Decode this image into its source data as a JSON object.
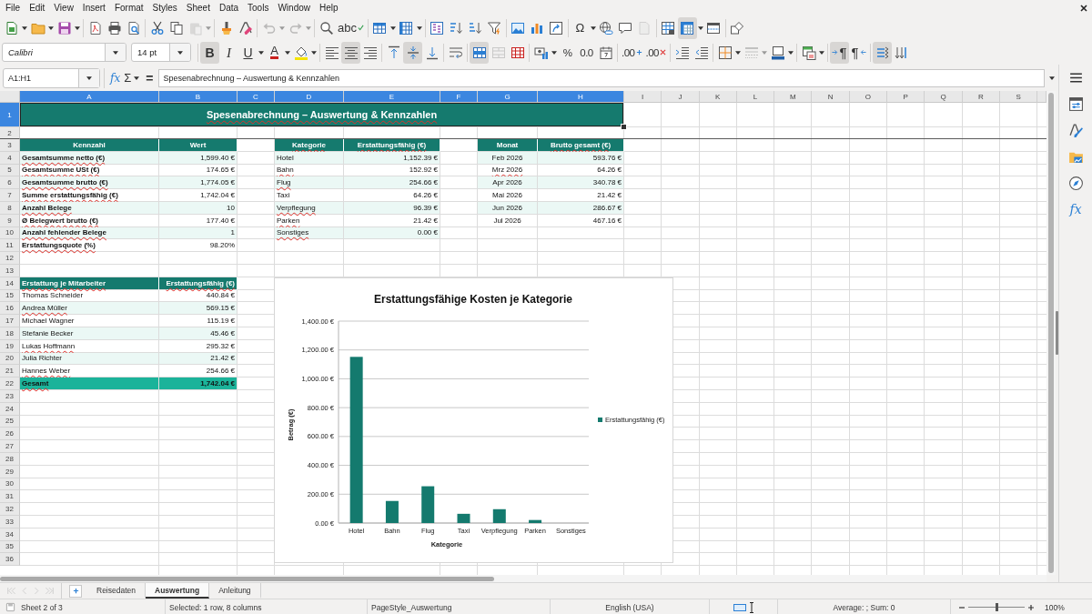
{
  "menu_bar": {
    "items": [
      "File",
      "Edit",
      "View",
      "Insert",
      "Format",
      "Styles",
      "Sheet",
      "Data",
      "Tools",
      "Window",
      "Help"
    ]
  },
  "standard_toolbar": {
    "buttons": [
      {
        "kind": "new",
        "pressed": false,
        "disabled": false
      },
      {
        "kind": "open",
        "pressed": false,
        "disabled": false
      },
      {
        "kind": "save",
        "pressed": false,
        "disabled": false
      },
      {
        "kind": "pdf",
        "pressed": false,
        "disabled": false
      },
      {
        "kind": "print",
        "pressed": false,
        "disabled": false
      },
      {
        "kind": "preview",
        "pressed": false,
        "disabled": false
      },
      {
        "kind": "cut",
        "pressed": false,
        "disabled": false
      },
      {
        "kind": "copy",
        "pressed": false,
        "disabled": false
      },
      {
        "kind": "paste",
        "pressed": false,
        "disabled": true
      },
      {
        "kind": "clone",
        "pressed": false,
        "disabled": false
      },
      {
        "kind": "clear",
        "pressed": false,
        "disabled": false
      },
      {
        "kind": "undo",
        "pressed": false,
        "disabled": true
      },
      {
        "kind": "redo",
        "pressed": false,
        "disabled": true
      },
      {
        "kind": "find",
        "pressed": false,
        "disabled": false
      },
      {
        "kind": "spelling",
        "glyph": "abc",
        "pressed": false,
        "disabled": false
      },
      {
        "kind": "rows",
        "pressed": false,
        "disabled": false
      },
      {
        "kind": "columns",
        "pressed": false,
        "disabled": false
      },
      {
        "kind": "sort",
        "pressed": false,
        "disabled": false
      },
      {
        "kind": "ascending",
        "pressed": false,
        "disabled": false
      },
      {
        "kind": "descending",
        "pressed": false,
        "disabled": false
      },
      {
        "kind": "filter",
        "pressed": false,
        "disabled": false
      },
      {
        "kind": "image",
        "pressed": false,
        "disabled": false
      },
      {
        "kind": "chart",
        "pressed": false,
        "disabled": false
      },
      {
        "kind": "pivot",
        "pressed": false,
        "disabled": false
      },
      {
        "kind": "character",
        "glyph": "Ω",
        "pressed": false,
        "disabled": false
      },
      {
        "kind": "hyperlink",
        "pressed": false,
        "disabled": false
      },
      {
        "kind": "comment",
        "pressed": false,
        "disabled": false
      },
      {
        "kind": "headers",
        "pressed": false,
        "disabled": true
      },
      {
        "kind": "area",
        "pressed": false,
        "disabled": false
      },
      {
        "kind": "freeze",
        "pressed": true,
        "disabled": false
      },
      {
        "kind": "split",
        "pressed": false,
        "disabled": false
      },
      {
        "kind": "shapes",
        "pressed": false,
        "disabled": false
      }
    ]
  },
  "formatting_toolbar": {
    "font_name": "Calibri",
    "font_size": "14 pt",
    "buttons": [
      {
        "kind": "bold",
        "glyph": "B",
        "pressed": true,
        "disabled": false
      },
      {
        "kind": "italic",
        "glyph": "I",
        "pressed": false,
        "disabled": false
      },
      {
        "kind": "underline",
        "glyph": "U",
        "pressed": false,
        "disabled": false
      },
      {
        "kind": "color",
        "glyph": "A",
        "pressed": false,
        "disabled": false
      },
      {
        "kind": "highlight",
        "pressed": false,
        "disabled": false
      },
      {
        "kind": "left",
        "pressed": false,
        "disabled": false
      },
      {
        "kind": "center",
        "pressed": true,
        "disabled": false
      },
      {
        "kind": "right",
        "pressed": false,
        "disabled": false
      },
      {
        "kind": "top",
        "pressed": false,
        "disabled": false
      },
      {
        "kind": "middle",
        "pressed": true,
        "disabled": false
      },
      {
        "kind": "bottom",
        "pressed": false,
        "disabled": false
      },
      {
        "kind": "wrap",
        "pressed": false,
        "disabled": false
      },
      {
        "kind": "merge",
        "pressed": true,
        "disabled": false
      },
      {
        "kind": "join",
        "pressed": false,
        "disabled": true
      },
      {
        "kind": "unmerge",
        "pressed": false,
        "disabled": false
      },
      {
        "kind": "currency",
        "pressed": false,
        "disabled": false
      },
      {
        "kind": "percent",
        "glyph": "%",
        "pressed": false,
        "disabled": false
      },
      {
        "kind": "decimal",
        "glyph": "0.0",
        "pressed": false,
        "disabled": false
      },
      {
        "kind": "date",
        "pressed": false,
        "disabled": false
      },
      {
        "kind": "more",
        "glyph": ".00",
        "pressed": false,
        "disabled": false
      },
      {
        "kind": "fewer",
        "glyph": ".00",
        "pressed": false,
        "disabled": false
      },
      {
        "kind": "indent",
        "pressed": false,
        "disabled": false
      },
      {
        "kind": "outdent",
        "pressed": false,
        "disabled": false
      },
      {
        "kind": "borders",
        "pressed": false,
        "disabled": false
      },
      {
        "kind": "lines",
        "pressed": false,
        "disabled": true
      },
      {
        "kind": "frame",
        "pressed": false,
        "disabled": false
      },
      {
        "kind": "conditional",
        "pressed": false,
        "disabled": false
      },
      {
        "kind": "ltr",
        "glyph": "¶",
        "pressed": true,
        "disabled": false
      },
      {
        "kind": "rtl",
        "glyph": "¶",
        "pressed": false,
        "disabled": false
      },
      {
        "kind": "direction",
        "pressed": true,
        "disabled": false
      },
      {
        "kind": "vertical",
        "pressed": false,
        "disabled": false
      }
    ]
  },
  "formula_bar": {
    "name_box": "A1:H1",
    "function_glyph": "fx",
    "sum_glyph": "Σ",
    "equals_glyph": "=",
    "content": "Spesenabrechnung – Auswertung & Kennzahlen"
  },
  "sheet": {
    "column_headers": [
      {
        "label": "A",
        "selected": true
      },
      {
        "label": "B",
        "selected": true
      },
      {
        "label": "C",
        "selected": true
      },
      {
        "label": "D",
        "selected": true
      },
      {
        "label": "E",
        "selected": true
      },
      {
        "label": "F",
        "selected": true
      },
      {
        "label": "G",
        "selected": true
      },
      {
        "label": "H",
        "selected": true
      },
      {
        "label": "I",
        "selected": false
      },
      {
        "label": "J",
        "selected": false
      },
      {
        "label": "K",
        "selected": false
      },
      {
        "label": "L",
        "selected": false
      },
      {
        "label": "M",
        "selected": false
      },
      {
        "label": "N",
        "selected": false
      },
      {
        "label": "O",
        "selected": false
      },
      {
        "label": "P",
        "selected": false
      },
      {
        "label": "Q",
        "selected": false
      },
      {
        "label": "R",
        "selected": false
      },
      {
        "label": "S",
        "selected": false
      }
    ],
    "row_headers": [
      {
        "label": "1",
        "selected": true
      },
      {
        "label": "2",
        "selected": false
      },
      {
        "label": "3",
        "selected": false
      },
      {
        "label": "4",
        "selected": false
      },
      {
        "label": "5",
        "selected": false
      },
      {
        "label": "6",
        "selected": false
      },
      {
        "label": "7",
        "selected": false
      },
      {
        "label": "8",
        "selected": false
      },
      {
        "label": "9",
        "selected": false
      },
      {
        "label": "10",
        "selected": false
      },
      {
        "label": "11",
        "selected": false
      },
      {
        "label": "12",
        "selected": false
      },
      {
        "label": "13",
        "selected": false
      },
      {
        "label": "14",
        "selected": false
      },
      {
        "label": "15",
        "selected": false
      },
      {
        "label": "16",
        "selected": false
      },
      {
        "label": "17",
        "selected": false
      },
      {
        "label": "18",
        "selected": false
      },
      {
        "label": "19",
        "selected": false
      },
      {
        "label": "20",
        "selected": false
      },
      {
        "label": "21",
        "selected": false
      },
      {
        "label": "22",
        "selected": false
      },
      {
        "label": "23",
        "selected": false
      },
      {
        "label": "24",
        "selected": false
      },
      {
        "label": "25",
        "selected": false
      },
      {
        "label": "26",
        "selected": false
      },
      {
        "label": "27",
        "selected": false
      },
      {
        "label": "28",
        "selected": false
      },
      {
        "label": "29",
        "selected": false
      },
      {
        "label": "30",
        "selected": false
      },
      {
        "label": "31",
        "selected": false
      },
      {
        "label": "32",
        "selected": false
      },
      {
        "label": "33",
        "selected": false
      },
      {
        "label": "34",
        "selected": false
      },
      {
        "label": "35",
        "selected": false
      },
      {
        "label": "36",
        "selected": false
      }
    ],
    "title": {
      "text": "Spesenabrechnung – Auswertung & Kennzahlen",
      "selected": true,
      "misspelled": true
    },
    "tables": [
      {
        "columns": [
          "Kennzahl",
          "Wert"
        ],
        "columns_misspelled": [
          false,
          false
        ],
        "rows": [
          {
            "cells": [
              "Gesamtsumme netto (€)",
              "1,599.40 €"
            ],
            "shaded": true,
            "misspelled": [
              true,
              false
            ]
          },
          {
            "cells": [
              "Gesamtsumme USt (€)",
              "174.65 €"
            ],
            "shaded": false,
            "misspelled": [
              true,
              false
            ]
          },
          {
            "cells": [
              "Gesamtsumme brutto (€)",
              "1,774.05 €"
            ],
            "shaded": true,
            "misspelled": [
              true,
              false
            ]
          },
          {
            "cells": [
              "Summe erstattungsfähig (€)",
              "1,742.04 €"
            ],
            "shaded": false,
            "misspelled": [
              true,
              false
            ]
          },
          {
            "cells": [
              "Anzahl Belege",
              "10"
            ],
            "shaded": true,
            "misspelled": [
              true,
              false
            ]
          },
          {
            "cells": [
              "Ø Belegwert brutto (€)",
              "177.40 €"
            ],
            "shaded": false,
            "misspelled": [
              true,
              false
            ]
          },
          {
            "cells": [
              "Anzahl fehlender Belege",
              "1"
            ],
            "shaded": true,
            "misspelled": [
              true,
              false
            ]
          },
          {
            "cells": [
              "Erstattungsquote (%)",
              "98.20%"
            ],
            "shaded": false,
            "misspelled": [
              true,
              false
            ]
          }
        ]
      },
      {
        "columns": [
          "Kategorie",
          "Erstattungsfähig (€)"
        ],
        "columns_misspelled": [
          true,
          true
        ],
        "rows": [
          {
            "cells": [
              "Hotel",
              "1,152.39 €"
            ],
            "shaded": true,
            "misspelled": [
              false,
              false
            ]
          },
          {
            "cells": [
              "Bahn",
              "152.92 €"
            ],
            "shaded": false,
            "misspelled": [
              true,
              false
            ]
          },
          {
            "cells": [
              "Flug",
              "254.66 €"
            ],
            "shaded": true,
            "misspelled": [
              true,
              false
            ]
          },
          {
            "cells": [
              "Taxi",
              "64.26 €"
            ],
            "shaded": false,
            "misspelled": [
              false,
              false
            ]
          },
          {
            "cells": [
              "Verpflegung",
              "96.39 €"
            ],
            "shaded": true,
            "misspelled": [
              true,
              false
            ]
          },
          {
            "cells": [
              "Parken",
              "21.42 €"
            ],
            "shaded": false,
            "misspelled": [
              true,
              false
            ]
          },
          {
            "cells": [
              "Sonstiges",
              "0.00 €"
            ],
            "shaded": true,
            "misspelled": [
              true,
              false
            ]
          }
        ]
      },
      {
        "columns": [
          "Monat",
          "Brutto gesamt (€)"
        ],
        "columns_misspelled": [
          false,
          true
        ],
        "rows": [
          {
            "cells": [
              "Feb 2026",
              "593.76 €"
            ],
            "shaded": true,
            "misspelled": [
              false,
              false
            ]
          },
          {
            "cells": [
              "Mrz 2026",
              "64.26 €"
            ],
            "shaded": false,
            "misspelled": [
              true,
              false
            ]
          },
          {
            "cells": [
              "Apr 2026",
              "340.78 €"
            ],
            "shaded": true,
            "misspelled": [
              false,
              false
            ]
          },
          {
            "cells": [
              "Mai 2026",
              "21.42 €"
            ],
            "shaded": false,
            "misspelled": [
              false,
              false
            ]
          },
          {
            "cells": [
              "Jun 2026",
              "286.67 €"
            ],
            "shaded": true,
            "misspelled": [
              false,
              false
            ]
          },
          {
            "cells": [
              "Jul 2026",
              "467.16 €"
            ],
            "shaded": false,
            "misspelled": [
              false,
              false
            ]
          }
        ]
      },
      {
        "columns": [
          "Erstattung je Mitarbeiter",
          "Erstattungsfähig (€)"
        ],
        "columns_misspelled": [
          true,
          true
        ],
        "rows": [
          {
            "cells": [
              "Thomas Schneider",
              "440.84 €"
            ],
            "shaded": false,
            "misspelled": [
              false,
              false
            ]
          },
          {
            "cells": [
              "Andrea Müller",
              "569.15 €"
            ],
            "shaded": true,
            "misspelled": [
              true,
              false
            ]
          },
          {
            "cells": [
              "Michael Wagner",
              "115.19 €"
            ],
            "shaded": false,
            "misspelled": [
              false,
              false
            ]
          },
          {
            "cells": [
              "Stefanie Becker",
              "45.46 €"
            ],
            "shaded": true,
            "misspelled": [
              false,
              false
            ]
          },
          {
            "cells": [
              "Lukas Hoffmann",
              "295.32 €"
            ],
            "shaded": false,
            "misspelled": [
              true,
              false
            ]
          },
          {
            "cells": [
              "Julia Richter",
              "21.42 €"
            ],
            "shaded": true,
            "misspelled": [
              false,
              false
            ]
          },
          {
            "cells": [
              "Hannes Weber",
              "254.66 €"
            ],
            "shaded": false,
            "misspelled": [
              true,
              false
            ]
          }
        ],
        "total_row": [
          "Gesamt",
          "1,742.04 €"
        ],
        "total_misspelled": [
          true,
          false
        ]
      }
    ],
    "chart": {
      "chart_data": {
        "type": "bar",
        "title": "Erstattungsfähige Kosten je Kategorie",
        "xlabel": "Kategorie",
        "ylabel": "Betrag (€)",
        "categories": [
          "Hotel",
          "Bahn",
          "Flug",
          "Taxi",
          "Verpflegung",
          "Parken",
          "Sonstiges"
        ],
        "series": [
          {
            "name": "Erstattungsfähig (€)",
            "color": "#147a6e",
            "values": [
              1152,
              153,
              255,
              64,
              96,
              21,
              0
            ]
          }
        ],
        "ylim": [
          0,
          1400
        ],
        "yticks": [
          {
            "value": 0,
            "label": "0.00 €"
          },
          {
            "value": 200,
            "label": "200.00 €"
          },
          {
            "value": 400,
            "label": "400.00 €"
          },
          {
            "value": 600,
            "label": "600.00 €"
          },
          {
            "value": 800,
            "label": "800.00 €"
          },
          {
            "value": 1000,
            "label": "1,000.00 €"
          },
          {
            "value": 1200,
            "label": "1,200.00 €"
          },
          {
            "value": 1400,
            "label": "1,400.00 €"
          }
        ],
        "grid": true
      }
    }
  },
  "sidebar": {
    "buttons": [
      {
        "kind": "menu"
      },
      {
        "kind": "properties"
      },
      {
        "kind": "styles"
      },
      {
        "kind": "gallery"
      },
      {
        "kind": "navigator"
      },
      {
        "kind": "functions",
        "glyph": "fx"
      }
    ]
  },
  "sheet_tabs": {
    "nav_buttons": [
      {
        "kind": "first",
        "disabled": true
      },
      {
        "kind": "previous",
        "disabled": true
      },
      {
        "kind": "next",
        "disabled": true
      },
      {
        "kind": "last",
        "disabled": true
      }
    ],
    "tabs": [
      {
        "label": "Reisedaten",
        "selected": false
      },
      {
        "label": "Auswertung",
        "selected": true
      },
      {
        "label": "Anleitung",
        "selected": false
      }
    ]
  },
  "status_bar": {
    "sheet_position": "Sheet 2 of 3",
    "selection": "Selected: 1 row, 8 columns",
    "page_style": "PageStyle_Auswertung",
    "language": "English (USA)",
    "statistics": "Average: ; Sum: 0",
    "zoom": {
      "level": 0.5,
      "reading": "100%"
    }
  }
}
